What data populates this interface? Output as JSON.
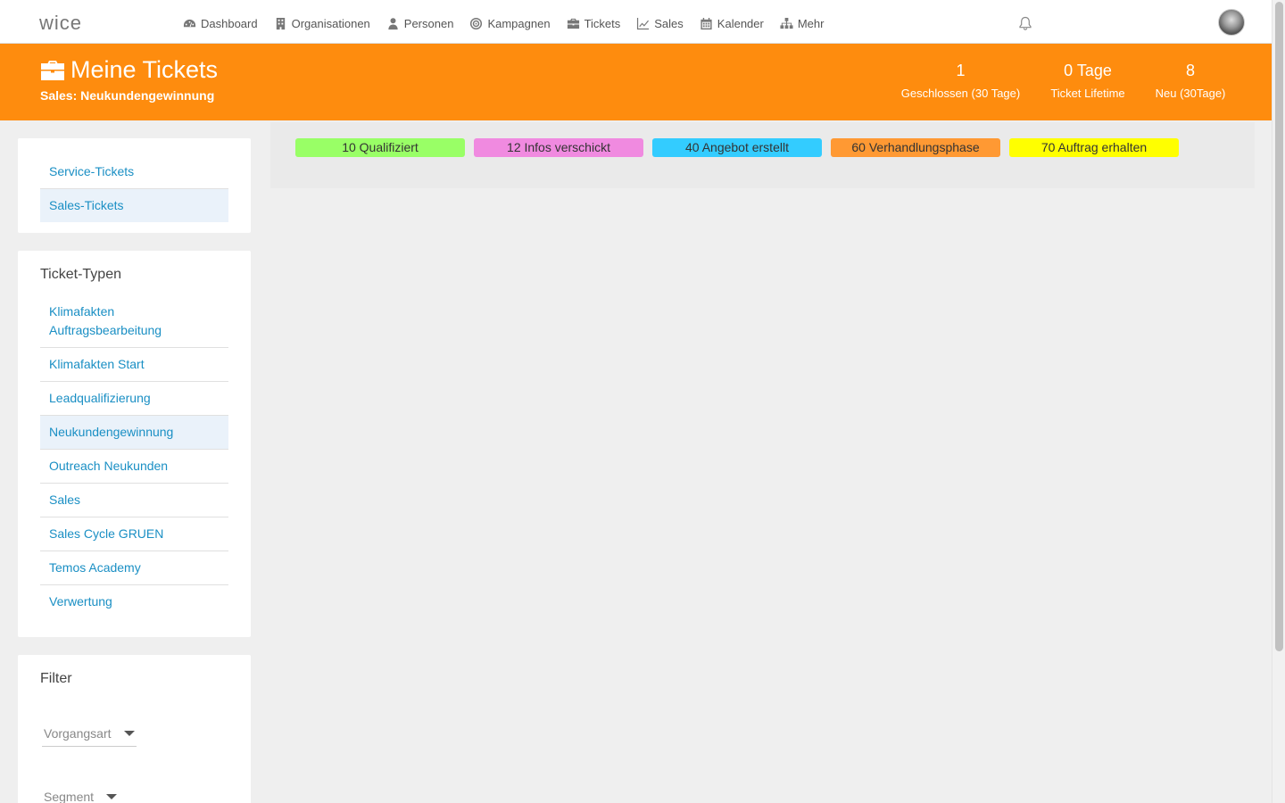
{
  "app": {
    "logo_text": "wice"
  },
  "nav": {
    "items": [
      {
        "label": "Dashboard",
        "icon": "dashboard-icon"
      },
      {
        "label": "Organisationen",
        "icon": "building-icon"
      },
      {
        "label": "Personen",
        "icon": "person-icon"
      },
      {
        "label": "Kampagnen",
        "icon": "target-icon"
      },
      {
        "label": "Tickets",
        "icon": "briefcase-icon"
      },
      {
        "label": "Sales",
        "icon": "chart-line-icon"
      },
      {
        "label": "Kalender",
        "icon": "calendar-icon"
      },
      {
        "label": "Mehr",
        "icon": "sitemap-icon"
      }
    ]
  },
  "header": {
    "title": "Meine Tickets",
    "subtitle": "Sales: Neukundengewinnung",
    "stats": [
      {
        "value": "1",
        "label": "Geschlossen (30 Tage)"
      },
      {
        "value": "0 Tage",
        "label": "Ticket Lifetime"
      },
      {
        "value": "8",
        "label": "Neu (30Tage)"
      }
    ]
  },
  "sidebar": {
    "ticket_groups": [
      {
        "label": "Service-Tickets",
        "active": false
      },
      {
        "label": "Sales-Tickets",
        "active": true
      }
    ],
    "types_title": "Ticket-Typen",
    "types": [
      {
        "label": "Klimafakten Auftragsbearbeitung",
        "active": false
      },
      {
        "label": "Klimafakten Start",
        "active": false
      },
      {
        "label": "Leadqualifizierung",
        "active": false
      },
      {
        "label": "Neukundengewinnung",
        "active": true
      },
      {
        "label": "Outreach Neukunden",
        "active": false
      },
      {
        "label": "Sales",
        "active": false
      },
      {
        "label": "Sales Cycle GRUEN",
        "active": false
      },
      {
        "label": "Temos Academy",
        "active": false
      },
      {
        "label": "Verwertung",
        "active": false
      }
    ],
    "filter_title": "Filter",
    "filters": [
      {
        "label": "Vorgangsart"
      },
      {
        "label": "Segment"
      }
    ]
  },
  "board": {
    "stages": [
      {
        "label": "10 Qualifiziert",
        "color": "#99ff66"
      },
      {
        "label": "12 Infos verschickt",
        "color": "#f08ae0"
      },
      {
        "label": "40 Angebot erstellt",
        "color": "#33ccff"
      },
      {
        "label": "60 Verhandlungsphase",
        "color": "#ff9933"
      },
      {
        "label": "70 Auftrag erhalten",
        "color": "#ffff00"
      }
    ]
  },
  "colors": {
    "accent": "#fe8c0e",
    "link": "#1a8fc4"
  }
}
